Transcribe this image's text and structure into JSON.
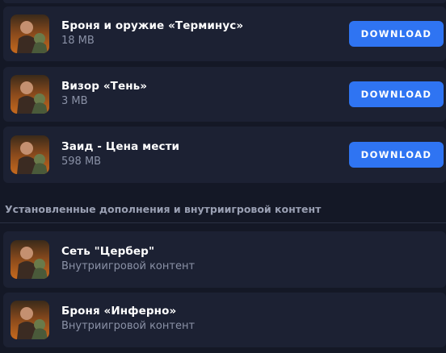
{
  "downloads": [
    {
      "title": "Броня и оружие «Терминус»",
      "size": "18 MB",
      "button_label": "DOWNLOAD"
    },
    {
      "title": "Визор «Тень»",
      "size": "3 MB",
      "button_label": "DOWNLOAD"
    },
    {
      "title": "Заид - Цена мести",
      "size": "598 MB",
      "button_label": "DOWNLOAD"
    }
  ],
  "installed_section": {
    "heading": "Установленные дополнения и внутриигровой контент",
    "items": [
      {
        "title": "Сеть \"Цербер\"",
        "subtitle": "Внутриигровой контент"
      },
      {
        "title": "Броня «Инферно»",
        "subtitle": "Внутриигровой контент"
      }
    ]
  },
  "colors": {
    "background": "#141826",
    "card": "#1c2133",
    "accent_button": "#2f74f2",
    "muted_text": "#8a91a6"
  },
  "icons": {
    "thumbnail": "game-cover-thumbnail"
  }
}
